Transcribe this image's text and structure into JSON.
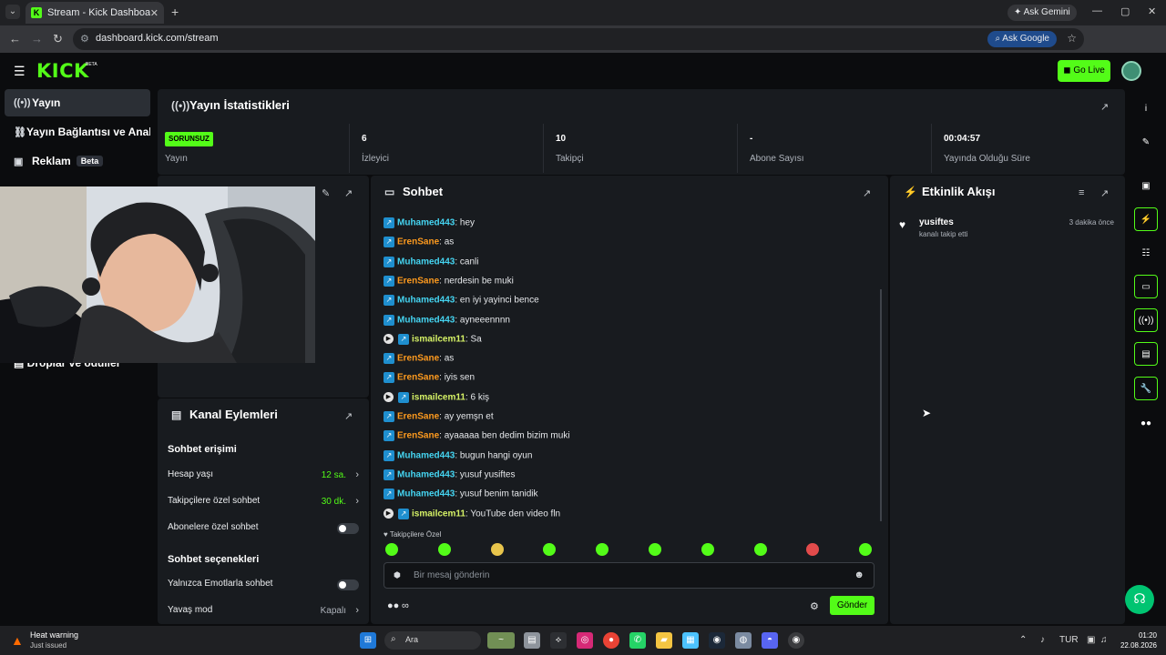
{
  "browser": {
    "tab_title": "Stream - Kick Dashboard",
    "ask_gemini": "Ask Gemini",
    "url": "dashboard.kick.com/stream",
    "ask_google": "Ask Google",
    "profile_initial": "K"
  },
  "app": {
    "logo": "KICK",
    "logo_badge": "BETA",
    "go_live": "Go Live"
  },
  "sidebar": {
    "items": [
      {
        "label": "Yayın",
        "icon": "broadcast-icon"
      },
      {
        "label": "Yayın Bağlantısı ve Anahtarı",
        "icon": "link-icon"
      },
      {
        "label": "Reklam",
        "icon": "ad-icon",
        "badge": "Beta"
      }
    ],
    "partial_item": "Droplar ve ödüller"
  },
  "stats": {
    "title": "Yayın İstatistikleri",
    "items": [
      {
        "value": "SORUNSUZ",
        "label": "Yayın"
      },
      {
        "value": "6",
        "label": "İzleyici"
      },
      {
        "value": "10",
        "label": "Takipçi"
      },
      {
        "value": "-",
        "label": "Abone Sayısı"
      },
      {
        "value": "00:04:57",
        "label": "Yayında Olduğu Süre"
      }
    ]
  },
  "channel_actions": {
    "title": "Kanal Eylemleri",
    "chat_access": "Sohbet erişimi",
    "account_age": {
      "label": "Hesap yaşı",
      "value": "12 sa."
    },
    "followers_chat": {
      "label": "Takipçilere özel sohbet",
      "value": "30 dk."
    },
    "subscribers_chat": {
      "label": "Abonelere özel sohbet"
    },
    "chat_options": "Sohbet seçenekleri",
    "emotes_only": {
      "label": "Yalnızca Emotlarla sohbet"
    },
    "slow_mode": {
      "label": "Yavaş mod",
      "value": "Kapalı"
    }
  },
  "chat": {
    "title": "Sohbet",
    "messages": [
      {
        "user": "Muhamed443",
        "text": ": hey",
        "color": "#45d5f2"
      },
      {
        "user": "ErenSane",
        "text": ": as",
        "color": "#ff9b1f"
      },
      {
        "user": "Muhamed443",
        "text": ": canli",
        "color": "#45d5f2"
      },
      {
        "user": "ErenSane",
        "text": ": nerdesin be muki",
        "color": "#ff9b1f"
      },
      {
        "user": "Muhamed443",
        "text": ": en iyi yayinci bence",
        "color": "#45d5f2"
      },
      {
        "user": "Muhamed443",
        "text": ": ayneeennnn",
        "color": "#45d5f2"
      },
      {
        "user": "ismailcem11",
        "text": ": Sa",
        "color": "#d6f266",
        "mod": true
      },
      {
        "user": "ErenSane",
        "text": ": as",
        "color": "#ff9b1f"
      },
      {
        "user": "ErenSane",
        "text": ": iyis sen",
        "color": "#ff9b1f"
      },
      {
        "user": "ismailcem11",
        "text": ": 6 kiş",
        "color": "#d6f266",
        "mod": true
      },
      {
        "user": "ErenSane",
        "text": ": ay yemşn et",
        "color": "#ff9b1f"
      },
      {
        "user": "ErenSane",
        "text": ": ayaaaaa ben dedim bizim muki",
        "color": "#ff9b1f"
      },
      {
        "user": "Muhamed443",
        "text": ": bugun hangi oyun",
        "color": "#45d5f2"
      },
      {
        "user": "Muhamed443",
        "text": ": yusuf yusiftes",
        "color": "#45d5f2"
      },
      {
        "user": "Muhamed443",
        "text": ": yusuf benim tanidik",
        "color": "#45d5f2"
      },
      {
        "user": "ismailcem11",
        "text": ": YouTube den video fln",
        "color": "#d6f266",
        "mod": true
      }
    ],
    "followers_only": "Takipçilere Özel",
    "placeholder": "Bir mesaj gönderin",
    "send": "Gönder"
  },
  "activity": {
    "title": "Etkinlik Akışı",
    "items": [
      {
        "user": "yusiftes",
        "time": "3 dakika önce",
        "description": "kanalı takip etti"
      }
    ]
  },
  "taskbar": {
    "warning_title": "Heat warning",
    "warning_subtitle": "Just issued",
    "search": "Ara",
    "language": "TUR",
    "time": "01:20",
    "date": "22.08.2026"
  },
  "colors": {
    "accent": "#53fc18",
    "panel": "#181b1f",
    "background": "#0b0c0e"
  }
}
